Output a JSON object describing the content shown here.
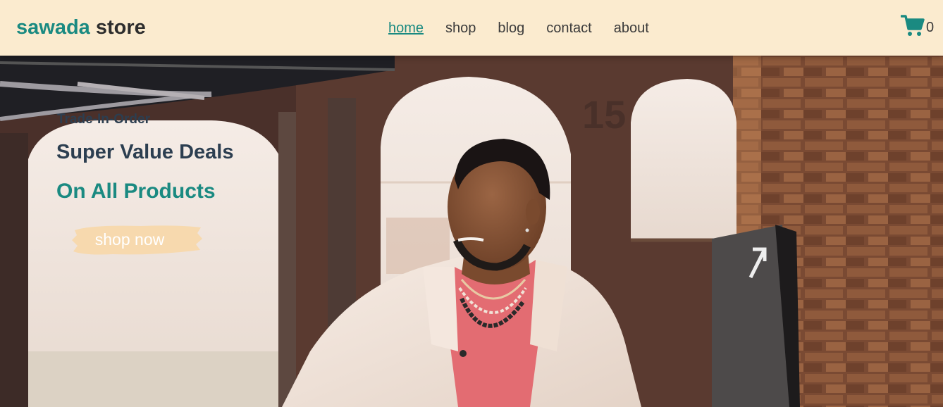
{
  "header": {
    "logo_brand": "sawada",
    "logo_suffix": "store",
    "nav": [
      {
        "label": "home",
        "active": true
      },
      {
        "label": "shop",
        "active": false
      },
      {
        "label": "blog",
        "active": false
      },
      {
        "label": "contact",
        "active": false
      },
      {
        "label": "about",
        "active": false
      }
    ],
    "cart": {
      "icon": "cart-icon",
      "count": "0"
    }
  },
  "hero": {
    "eyebrow": "Trade-In-Order",
    "headline": "Super Value Deals",
    "subheadline": "On All Products",
    "cta_label": "shop now",
    "image": "model-portrait-photo"
  },
  "colors": {
    "accent": "#1a8a81",
    "header_bg": "#fbebcf",
    "heading": "#2c3e50",
    "cta_bg": "#f7d9ae"
  }
}
